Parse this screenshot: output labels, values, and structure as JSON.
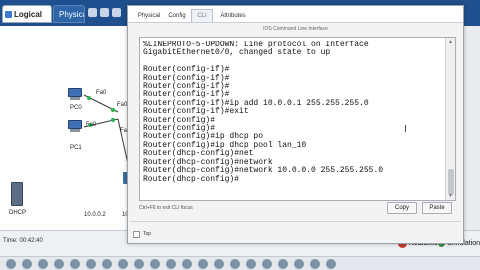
{
  "toolbar": {
    "logical_label": "Logical",
    "physical_label": "Physical",
    "colors": {
      "bar": "#1f4f8c"
    }
  },
  "workspace": {
    "pc0_label": "PC0",
    "pc1_label": "PC1",
    "link_fa0_top": "Fa0",
    "link_fa0_2": "Fa0/2",
    "link_fa0_bottom": "Fa0",
    "link_fa": "Fa",
    "server_label": "DHCP",
    "ip_label": "10.0.0.2",
    "ip_label_partial": "10"
  },
  "dialog": {
    "tabs": [
      {
        "label": "Physical",
        "active": false
      },
      {
        "label": "Config",
        "active": false
      },
      {
        "label": "CLI",
        "active": true
      },
      {
        "label": "Attributes",
        "active": false
      }
    ],
    "panel_title": "IOS Command Line Interface",
    "terminal_lines": [
      "%LINEPROTO-5-UPDOWN: Line protocol on Interface",
      "GigabitEthernet0/0, changed state to up",
      "",
      "Router(config-if)#",
      "Router(config-if)#",
      "Router(config-if)#",
      "Router(config-if)#",
      "Router(config-if)#ip add 10.0.0.1 255.255.255.0",
      "Router(config-if)#exit",
      "Router(config)#",
      "Router(config)#",
      "Router(config)#ip dhcp po",
      "Router(config)#ip dhcp pool lan_10",
      "Router(dhcp-config)#net",
      "Router(dhcp-config)#network",
      "Router(dhcp-config)#network 10.0.0.0 255.255.255.0",
      "Router(dhcp-config)#"
    ],
    "hint": "Ctrl+F6 to exit CLI focus",
    "copy_label": "Copy",
    "paste_label": "Paste",
    "top_label": "Top"
  },
  "statusbar": {
    "time": "Time: 00:42:40",
    "realtime_label": "Realtime",
    "simulation_label": "Simulation"
  }
}
